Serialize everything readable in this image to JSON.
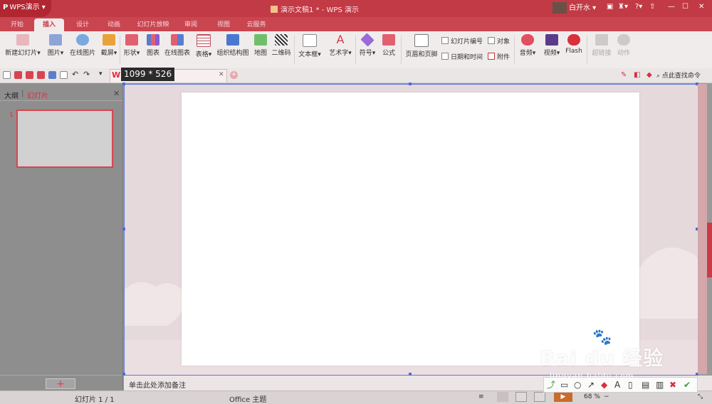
{
  "app": {
    "name": "WPS演示",
    "logo_glyph": "P",
    "document_title": "演示文稿1 * - WPS 演示",
    "user_name": "白开水"
  },
  "colors": {
    "accent": "#c23a45",
    "ribbon_bg": "#f0ecec",
    "canvas_bg": "#e6d9db",
    "selection": "#5e7ad8"
  },
  "tabs": [
    "开始",
    "插入",
    "设计",
    "动画",
    "幻灯片放映",
    "审阅",
    "视图",
    "云服务"
  ],
  "active_tab": "插入",
  "ribbon": {
    "new_slide": "新建幻灯片",
    "picture": "图片",
    "online_picture": "在线图片",
    "screenshot": "截屏",
    "shape": "形状",
    "chart": "图表",
    "online_chart": "在线图表",
    "table": "表格",
    "org_chart": "组织结构图",
    "map": "地图",
    "qrcode": "二维码",
    "textbox": "文本框",
    "wordart": "艺术字",
    "symbol": "符号",
    "formula": "公式",
    "header_footer": "页眉和页脚",
    "slide_number": "幻灯片编号",
    "date_time": "日期和时间",
    "object": "对象",
    "attachment": "附件",
    "audio": "音频",
    "video": "视频",
    "flash": "Flash",
    "hyperlink": "超链接",
    "action": "动作"
  },
  "quickbar": {
    "selection_size": "1099 * 526",
    "find_command": "点此查找命令"
  },
  "left_panel": {
    "tab_outline": "大纲",
    "tab_slides": "幻灯片",
    "slide_number": "1",
    "add_button": "+"
  },
  "notes": {
    "placeholder": "单击此处添加备注"
  },
  "status": {
    "slide_count": "幻灯片 1 / 1",
    "theme": "Office 主题",
    "zoom": "68 %"
  },
  "watermark": {
    "brand": "Bai du 经验",
    "url": "jingyan.baidu.com"
  }
}
